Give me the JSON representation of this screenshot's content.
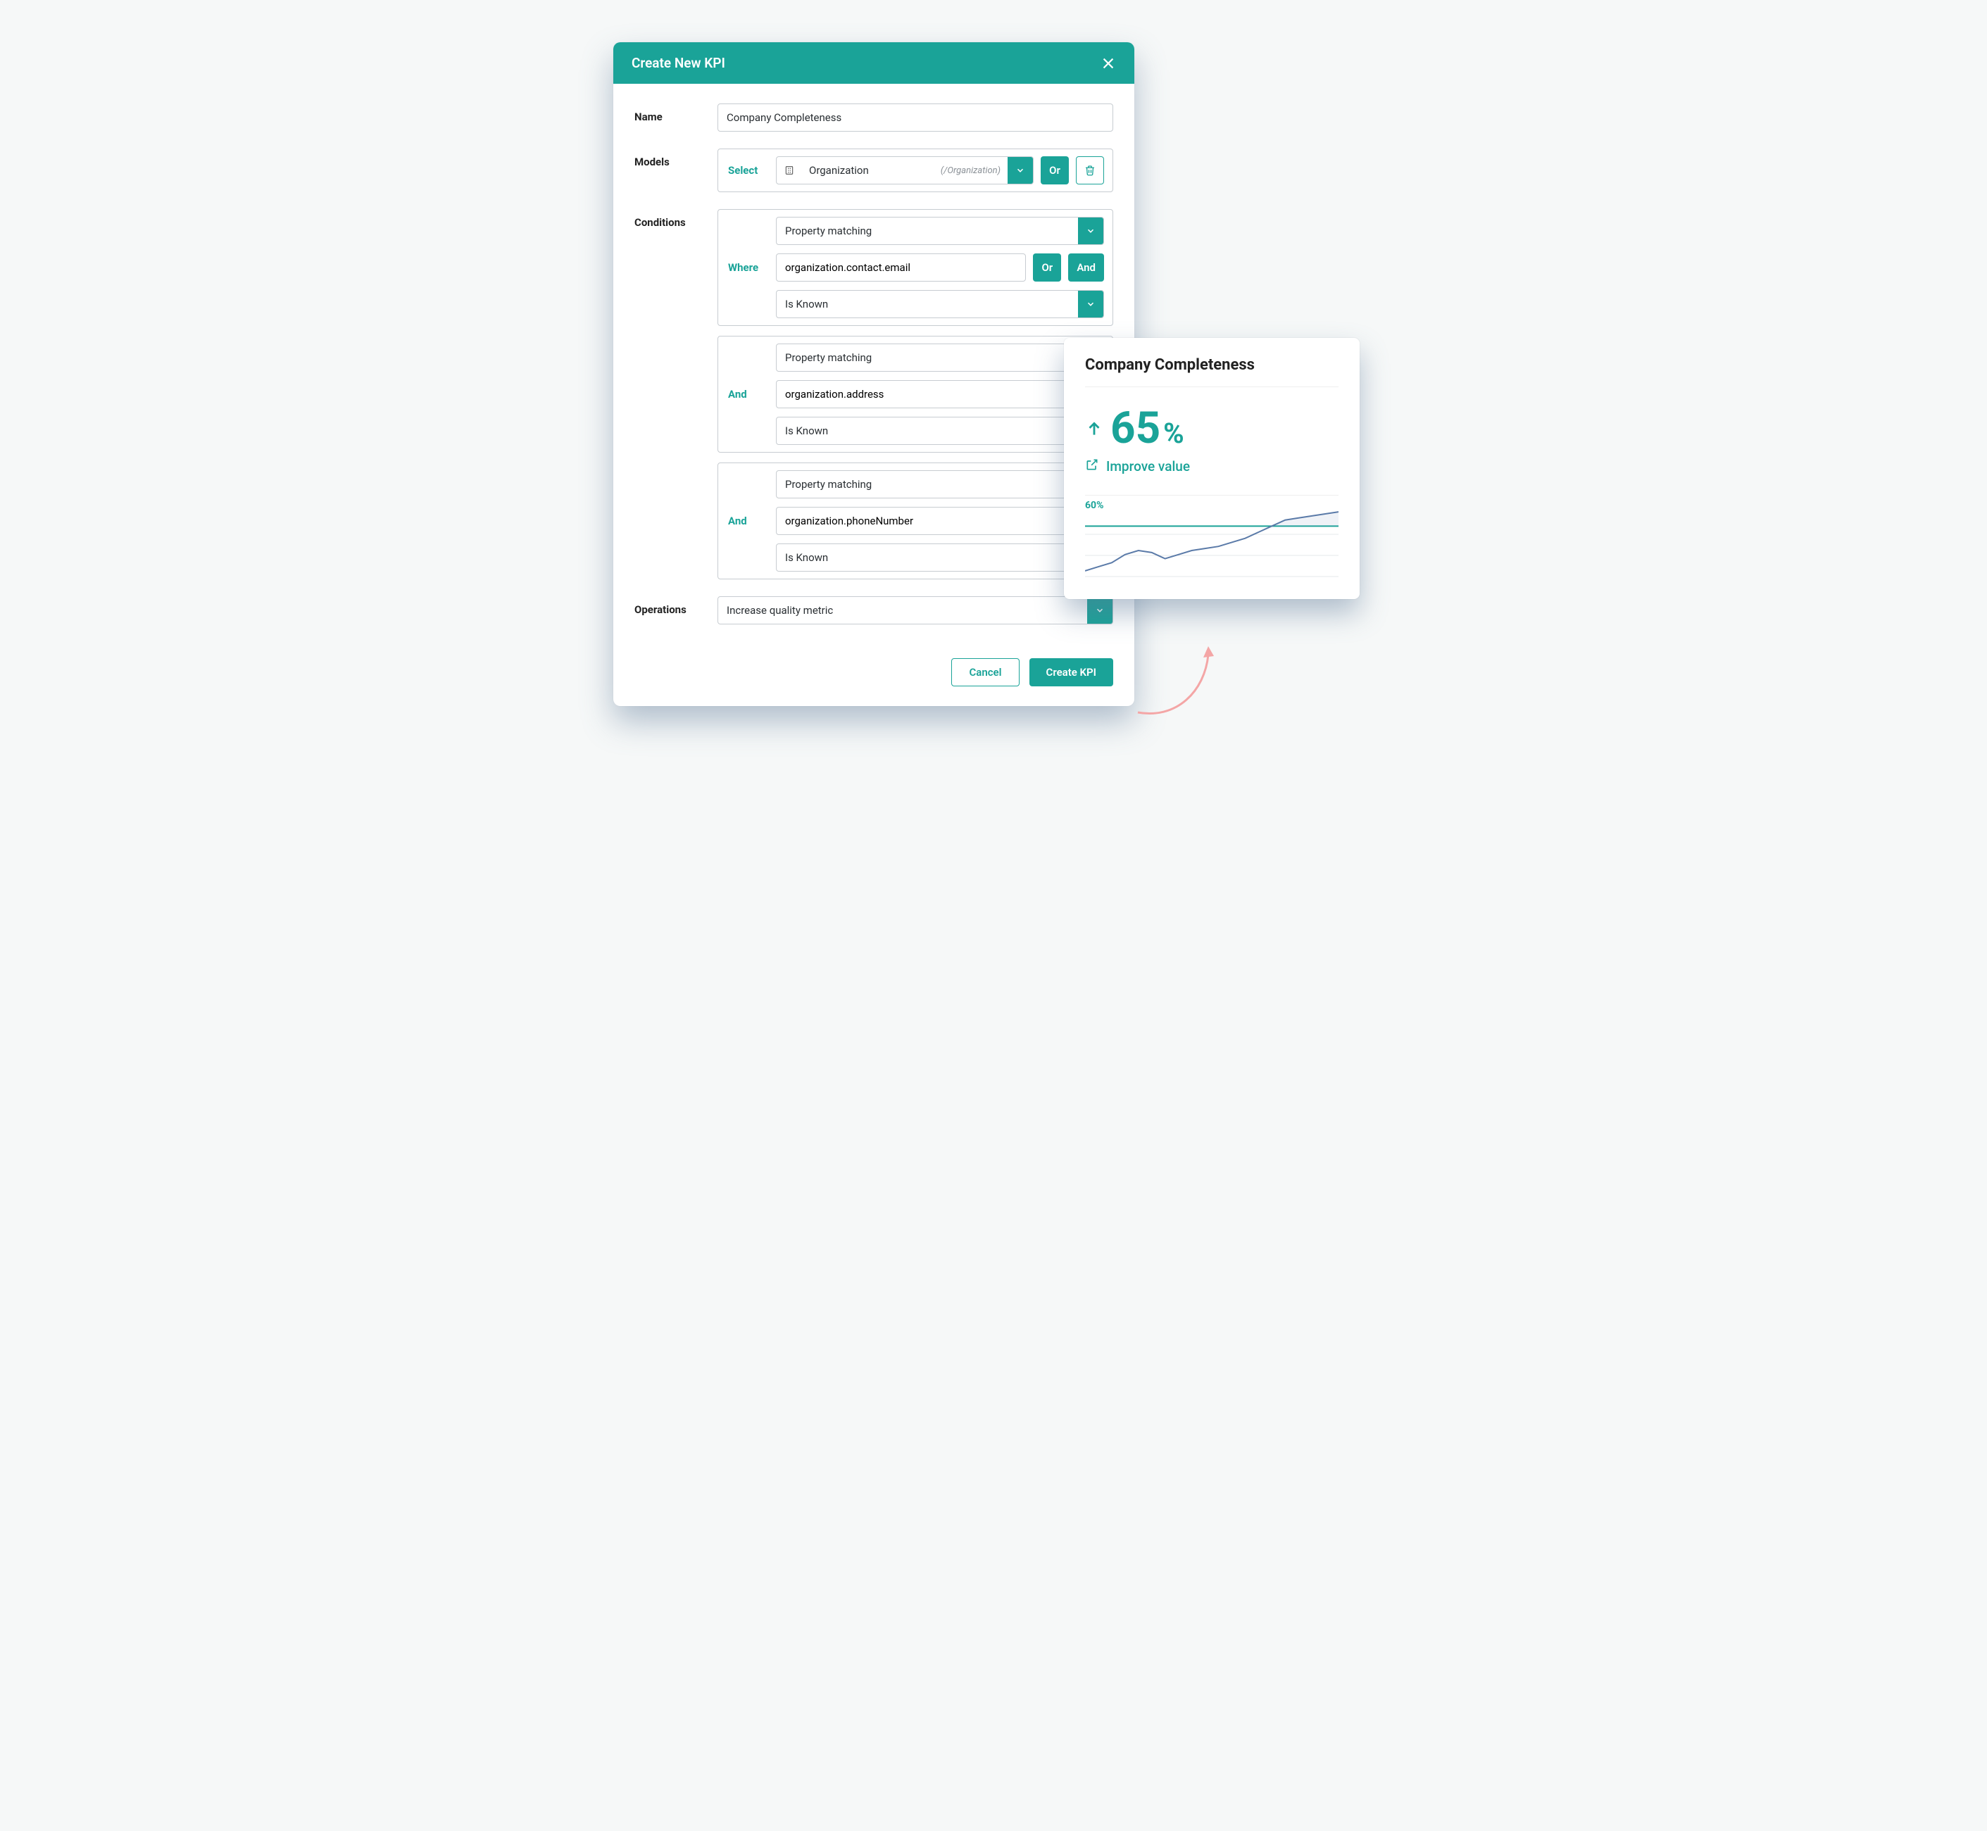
{
  "modal": {
    "title": "Create New KPI",
    "labels": {
      "name": "Name",
      "models": "Models",
      "conditions": "Conditions",
      "operations": "Operations"
    },
    "name_value": "Company Completeness",
    "models": {
      "select_label": "Select",
      "entity": "Organization",
      "entity_path": "(/Organization)",
      "or_label": "Or"
    },
    "condition_common": {
      "or_label": "Or",
      "and_label": "And"
    },
    "conditions": [
      {
        "connector": "Where",
        "match_type": "Property matching",
        "property": "organization.contact.email",
        "operator": "Is Known",
        "show_and": true
      },
      {
        "connector": "And",
        "match_type": "Property matching",
        "property": "organization.address",
        "operator": "Is Known",
        "show_and": false
      },
      {
        "connector": "And",
        "match_type": "Property matching",
        "property": "organization.phoneNumber",
        "operator": "Is Known",
        "show_and": false
      }
    ],
    "operation": "Increase quality metric",
    "buttons": {
      "cancel": "Cancel",
      "create": "Create KPI"
    }
  },
  "kpi": {
    "title": "Company Completeness",
    "value": "65",
    "percent": "%",
    "link": "Improve value",
    "threshold_label": "60%"
  },
  "chart_data": {
    "type": "line",
    "title": "Company Completeness",
    "ylabel": "",
    "xlabel": "",
    "ylim": [
      30,
      75
    ],
    "threshold": 60,
    "threshold_label": "60%",
    "x": [
      0,
      1,
      2,
      3,
      4,
      5,
      6,
      7,
      8,
      9,
      10,
      11,
      12,
      13,
      14,
      15,
      16,
      17,
      18,
      19
    ],
    "values": [
      38,
      40,
      42,
      46,
      48,
      47,
      44,
      46,
      48,
      49,
      50,
      52,
      54,
      57,
      60,
      63,
      64,
      65,
      66,
      67
    ]
  }
}
